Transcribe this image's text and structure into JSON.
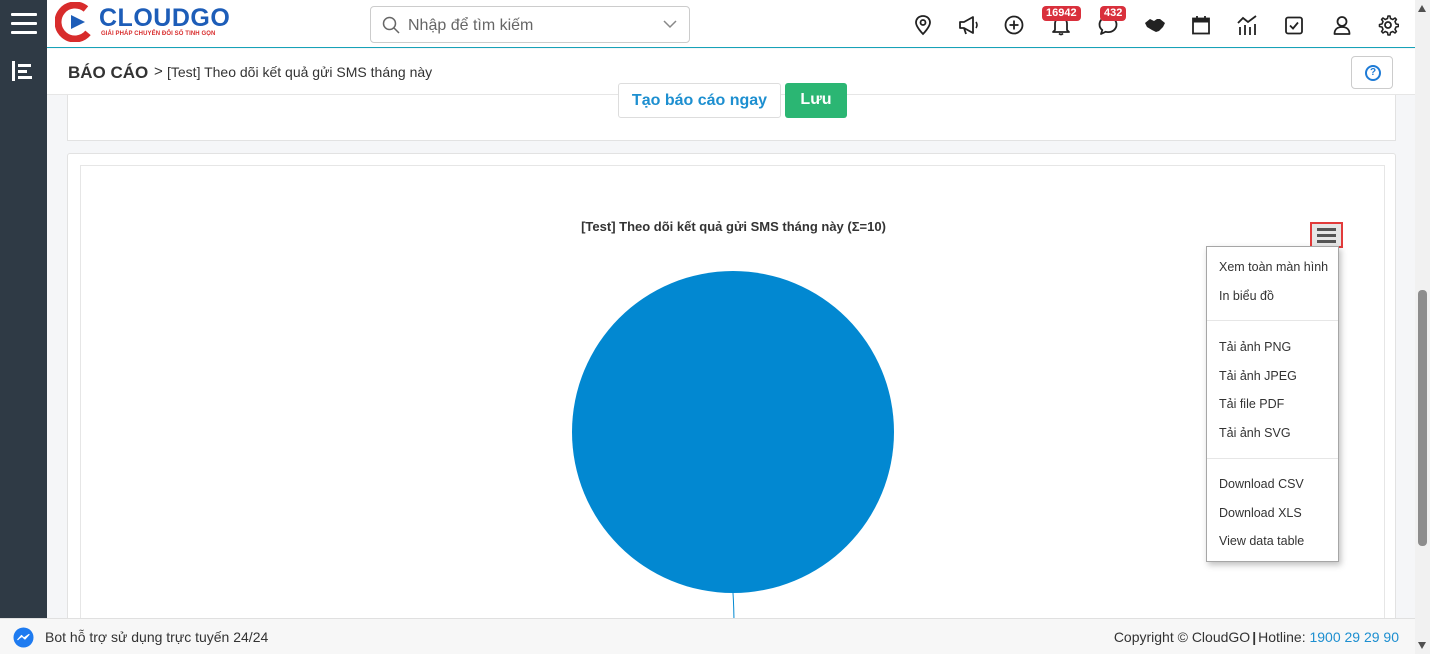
{
  "header": {
    "logo_text": "CLOUDGO",
    "logo_tagline": "GIẢI PHÁP CHUYỂN ĐỔI SỐ TINH GỌN",
    "search_placeholder": "Nhập để tìm kiếm",
    "notifications_badge": "16942",
    "messages_badge": "432",
    "icons": [
      "map-pin-icon",
      "megaphone-icon",
      "plus-circle-icon",
      "bell-icon",
      "chat-icon",
      "handshake-icon",
      "calendar-icon",
      "chart-line-icon",
      "checkbox-icon",
      "user-icon",
      "gear-icon"
    ]
  },
  "breadcrumb": {
    "root": "BÁO CÁO",
    "separator": ">",
    "current": "[Test] Theo dõi kết quả gửi SMS tháng này"
  },
  "actions": {
    "create_label": "Tạo báo cáo ngay",
    "save_label": "Lưu"
  },
  "export_menu": {
    "items": [
      "Xem toàn màn hình",
      "In biểu đồ",
      "Tải ảnh PNG",
      "Tải ảnh JPEG",
      "Tải file PDF",
      "Tải ảnh SVG",
      "Download CSV",
      "Download XLS",
      "View data table"
    ]
  },
  "chart_data": {
    "type": "pie",
    "title": "[Test] Theo dõi kết quả gửi SMS tháng này (Σ=10)",
    "slices": [
      {
        "value": 10,
        "color": "#0288d1"
      }
    ],
    "total": 10
  },
  "footer": {
    "bot_text": "Bot hỗ trợ sử dụng trực tuyến 24/24",
    "copyright": "Copyright © CloudGO",
    "hotline_label": "Hotline:",
    "hotline_number": "1900 29 29 90"
  },
  "colors": {
    "accent": "#1d8fd0",
    "save_green": "#2bb673",
    "badge_red": "#d9303c",
    "rail": "#2f3a45"
  }
}
